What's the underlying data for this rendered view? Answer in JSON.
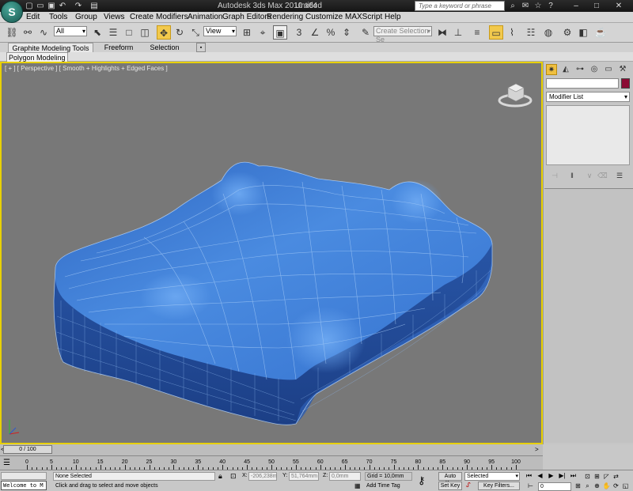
{
  "titlebar": {
    "app_title": "Autodesk 3ds Max  2010 x64",
    "doc_title": "Untitled",
    "search_placeholder": "Type a keyword or phrase"
  },
  "menu": [
    "Edit",
    "Tools",
    "Group",
    "Views",
    "Create",
    "Modifiers",
    "Animation",
    "Graph Editors",
    "Rendering",
    "Customize",
    "MAXScript",
    "Help"
  ],
  "toolbar": {
    "selection_filter": "All",
    "ref_coord": "View",
    "named_selection_placeholder": "Create Selection Se"
  },
  "ribbon": {
    "tabs": [
      "Graphite Modeling Tools",
      "Freeform",
      "Selection"
    ],
    "active_panel": "Polygon Modeling"
  },
  "viewport": {
    "label": "[ + ] [ Perspective ] [ Smooth + Highlights + Edged Faces ]",
    "mesh_color": "#3f7fd6",
    "wire_color": "#a8cdf8",
    "border_color": "#e8d000"
  },
  "command_panel": {
    "modifier_list": "Modifier List",
    "object_color": "#8b0b34"
  },
  "timeline": {
    "frame_display": "0 / 100",
    "ticks": [
      0,
      5,
      10,
      15,
      20,
      25,
      30,
      35,
      40,
      45,
      50,
      55,
      60,
      65,
      70,
      75,
      80,
      85,
      90,
      95,
      100
    ]
  },
  "status": {
    "maxscript_text": "Welcome to M",
    "selection_text": "None Selected",
    "prompt_text": "Click and drag to select and move objects",
    "x_value": "-206,238m",
    "y_value": "51,764mm",
    "z_value": "0,0mm",
    "grid_text": "Grid = 10,0mm",
    "add_time_tag": "Add Time Tag",
    "auto_key": "Auto Key",
    "set_key": "Set Key",
    "key_mode": "Selected",
    "key_filters": "Key Filters...",
    "current_frame": "0"
  }
}
